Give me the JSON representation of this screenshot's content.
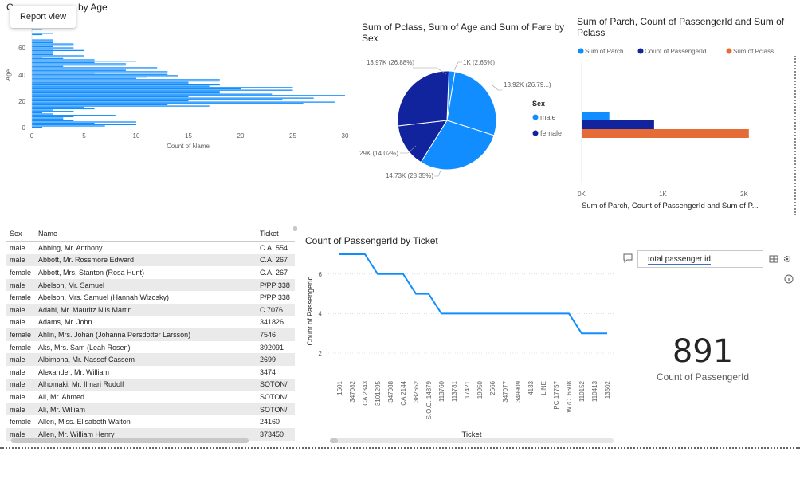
{
  "tooltip": {
    "text": "Report view"
  },
  "age_chart": {
    "title_left": "C",
    "title_right": "by Age",
    "xlabel": "Count of Name",
    "ylabel": "Age",
    "x_ticks": [
      "0",
      "5",
      "10",
      "15",
      "20",
      "25",
      "30"
    ],
    "y_ticks": [
      "60",
      "40",
      "20",
      "0"
    ],
    "color": "#118DFF"
  },
  "pie_chart": {
    "title": "Sum of Pclass, Sum of Age and Sum of Fare by Sex",
    "legend_title": "Sex",
    "legend": [
      {
        "name": "male",
        "color": "#118DFF"
      },
      {
        "name": "female",
        "color": "#12239E"
      }
    ],
    "labels": [
      "13.97K (26.88%)",
      "1K (2.65%)",
      "13.92K (26.79...)",
      "7.29K (14.02%)",
      "14.73K (28.35%)"
    ]
  },
  "bar_chart": {
    "title": "Sum of Parch, Count of PassengerId and Sum of Pclass",
    "legend": [
      {
        "name": "Sum of Parch",
        "color": "#118DFF"
      },
      {
        "name": "Count of PassengerId",
        "color": "#12239E"
      },
      {
        "name": "Sum of Pclass",
        "color": "#E66C37"
      }
    ],
    "x_ticks": [
      "0K",
      "1K",
      "2K"
    ],
    "xlabel": "Sum of Parch, Count of PassengerId and Sum of P..."
  },
  "table": {
    "headers": [
      "Sex",
      "Name",
      "Ticket"
    ],
    "rows": [
      [
        "male",
        "Abbing, Mr. Anthony",
        "C.A. 554"
      ],
      [
        "male",
        "Abbott, Mr. Rossmore Edward",
        "C.A. 267"
      ],
      [
        "female",
        "Abbott, Mrs. Stanton (Rosa Hunt)",
        "C.A. 267"
      ],
      [
        "male",
        "Abelson, Mr. Samuel",
        "P/PP 338"
      ],
      [
        "female",
        "Abelson, Mrs. Samuel (Hannah Wizosky)",
        "P/PP 338"
      ],
      [
        "male",
        "Adahl, Mr. Mauritz Nils Martin",
        "C 7076"
      ],
      [
        "male",
        "Adams, Mr. John",
        "341826"
      ],
      [
        "female",
        "Ahlin, Mrs. Johan (Johanna Persdotter Larsson)",
        "7546"
      ],
      [
        "female",
        "Aks, Mrs. Sam (Leah Rosen)",
        "392091"
      ],
      [
        "male",
        "Albimona, Mr. Nassef Cassem",
        "2699"
      ],
      [
        "male",
        "Alexander, Mr. William",
        "3474"
      ],
      [
        "male",
        "Alhomaki, Mr. Ilmari Rudolf",
        "SOTON/"
      ],
      [
        "male",
        "Ali, Mr. Ahmed",
        "SOTON/"
      ],
      [
        "male",
        "Ali, Mr. William",
        "SOTON/"
      ],
      [
        "female",
        "Allen, Miss. Elisabeth Walton",
        "24160"
      ],
      [
        "male",
        "Allen, Mr. William Henry",
        "373450"
      ]
    ]
  },
  "line_chart": {
    "title": "Count of PassengerId by Ticket",
    "xlabel": "Ticket",
    "ylabel": "Count of PassengerId",
    "y_ticks": [
      "6",
      "4",
      "2"
    ],
    "color": "#118DFF"
  },
  "chart_data": [
    {
      "type": "bar",
      "title": "",
      "xlabel": "Count of Name",
      "ylabel": "Age",
      "xlim": [
        0,
        30
      ],
      "ylim": [
        0,
        80
      ],
      "note_orientation": "horizontal",
      "categories": [
        80,
        74,
        71,
        70,
        66,
        65,
        64,
        63,
        62,
        61,
        60,
        59,
        58,
        57,
        56,
        55,
        54,
        53,
        52,
        51,
        50,
        49,
        48,
        47,
        46,
        45,
        44,
        43,
        42,
        41,
        40,
        39,
        38,
        37,
        36,
        35,
        34,
        33,
        32,
        31,
        30,
        29,
        28,
        27,
        26,
        25,
        24,
        23,
        22,
        21,
        20,
        19,
        18,
        17,
        16,
        15,
        14,
        13,
        12,
        11,
        10,
        9,
        8,
        7,
        6,
        5,
        4,
        3,
        2,
        1,
        0
      ],
      "values": [
        1,
        1,
        2,
        1,
        2,
        2,
        2,
        4,
        4,
        2,
        4,
        2,
        5,
        2,
        2,
        2,
        5,
        1,
        3,
        6,
        10,
        6,
        9,
        9,
        3,
        12,
        9,
        9,
        13,
        6,
        13,
        14,
        11,
        10,
        18,
        18,
        15,
        15,
        18,
        17,
        25,
        20,
        25,
        18,
        18,
        23,
        30,
        15,
        27,
        24,
        15,
        29,
        26,
        13,
        17,
        5,
        6,
        2,
        4,
        1,
        2,
        8,
        4,
        3,
        3,
        4,
        10,
        6,
        10,
        7,
        1
      ]
    },
    {
      "type": "pie",
      "title": "Sum of Pclass, Sum of Age and Sum of Fare by Sex",
      "slices": [
        {
          "label": "13.97K (26.88%)",
          "value": 13970,
          "color": "#12239E"
        },
        {
          "label": "1K (2.65%)",
          "value": 1000,
          "color": "#118DFF"
        },
        {
          "label": "13.92K (26.79...)",
          "value": 13920,
          "color": "#118DFF"
        },
        {
          "label": "14.73K (28.35%)",
          "value": 14730,
          "color": "#118DFF"
        },
        {
          "label": "7.29K (14.02%)",
          "value": 7290,
          "color": "#12239E"
        }
      ]
    },
    {
      "type": "bar",
      "title": "Sum of Parch, Count of PassengerId and Sum of Pclass",
      "xlim": [
        0,
        2500
      ],
      "categories": [
        ""
      ],
      "series": [
        {
          "name": "Sum of Parch",
          "values": [
            340
          ],
          "color": "#118DFF"
        },
        {
          "name": "Count of PassengerId",
          "values": [
            891
          ],
          "color": "#12239E"
        },
        {
          "name": "Sum of Pclass",
          "values": [
            2057
          ],
          "color": "#E66C37"
        }
      ]
    },
    {
      "type": "line",
      "title": "Count of PassengerId by Ticket",
      "xlabel": "Ticket",
      "ylabel": "Count of PassengerId",
      "ylim": [
        1,
        7.5
      ],
      "x": [
        "1601",
        "347082",
        "CA 2343",
        "3101295",
        "347088",
        "CA 2144",
        "382652",
        "S.O.C. 14879",
        "113760",
        "113781",
        "17421",
        "19950",
        "2666",
        "347077",
        "349909",
        "4133",
        "LINE",
        "PC 17757",
        "W./C. 6608",
        "110152",
        "110413",
        "13502"
      ],
      "x_visible_ticks": [
        "1601",
        "347082",
        "CA 2343",
        "3101295",
        "347088",
        "CA 2144",
        "382652",
        "S.O.C. 14879",
        "113760",
        "113781",
        "17421",
        "19950",
        "2666",
        "347077",
        "349909",
        "4133",
        "LINE",
        "PC 17757",
        "W./C. 6608",
        "110152",
        "110413",
        "13502"
      ],
      "values": [
        7,
        7,
        7,
        6,
        6,
        6,
        5,
        5,
        4,
        4,
        4,
        4,
        4,
        4,
        4,
        4,
        4,
        4,
        4,
        3,
        3,
        3
      ]
    }
  ],
  "card": {
    "value": "891",
    "label": "Count of PassengerId"
  },
  "qa": {
    "input": "total passenger id"
  }
}
